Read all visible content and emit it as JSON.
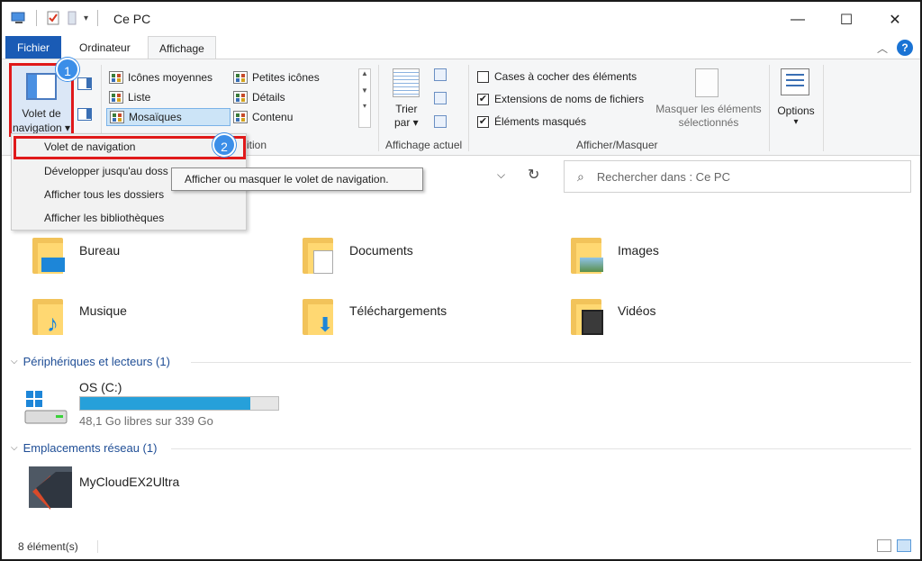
{
  "window": {
    "title": "Ce PC",
    "minimize": "—",
    "maximize": "☐",
    "close": "✕"
  },
  "tabs": {
    "file": "Fichier",
    "computer": "Ordinateur",
    "view": "Affichage"
  },
  "ribbon": {
    "panes": {
      "nav_label_1": "Volet de",
      "nav_label_2": "navigation ▾"
    },
    "layout": {
      "items": [
        "Icônes moyennes",
        "Petites icônes",
        "Liste",
        "Détails",
        "Mosaïques",
        "Contenu"
      ],
      "group_label_partial": "ition"
    },
    "current_view": {
      "sort_label_1": "Trier",
      "sort_label_2": "par ▾",
      "group_label": "Affichage actuel"
    },
    "show_hide": {
      "checkboxes": [
        {
          "label": "Cases à cocher des éléments",
          "checked": false
        },
        {
          "label": "Extensions de noms de fichiers",
          "checked": true
        },
        {
          "label": "Éléments masqués",
          "checked": true
        }
      ],
      "hide_selected_1": "Masquer les éléments",
      "hide_selected_2": "sélectionnés",
      "group_label": "Afficher/Masquer"
    },
    "options": {
      "label": "Options",
      "arrow": "▾"
    }
  },
  "dropdown": {
    "items": [
      "Volet de navigation",
      "Développer jusqu'au doss",
      "Afficher tous les dossiers",
      "Afficher les bibliothèques"
    ]
  },
  "tooltip": "Afficher ou masquer le volet de navigation.",
  "markers": [
    "1",
    "2"
  ],
  "search": {
    "placeholder": "Rechercher dans : Ce PC"
  },
  "folders": [
    {
      "name": "Bureau"
    },
    {
      "name": "Documents"
    },
    {
      "name": "Images"
    },
    {
      "name": "Musique"
    },
    {
      "name": "Téléchargements"
    },
    {
      "name": "Vidéos"
    }
  ],
  "devices": {
    "header": "Périphériques et lecteurs (1)",
    "drive": {
      "name": "OS (C:)",
      "free": "48,1 Go libres sur 339 Go",
      "used_fraction": 0.858
    }
  },
  "network": {
    "header": "Emplacements réseau (1)",
    "item": "MyCloudEX2Ultra"
  },
  "status": {
    "count": "8 élément(s)"
  },
  "colors": {
    "accent": "#1a5bb5",
    "highlight_red": "#e0191a",
    "marker_blue": "#3b8ee8",
    "folder_yellow": "#ffd872",
    "drive_fill": "#26a0da"
  }
}
